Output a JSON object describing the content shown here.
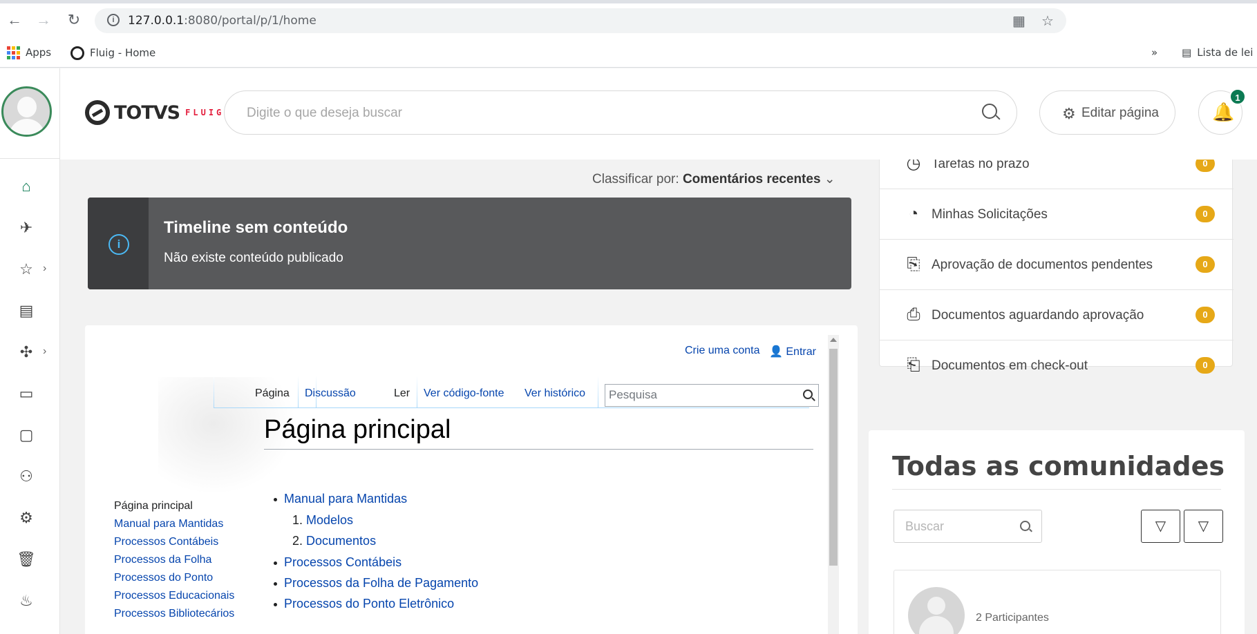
{
  "browser": {
    "back_icon": "back-arrow-icon",
    "url_host": "127.0.0.1",
    "url_rest": ":8080/portal/p/1/home",
    "bookmarks": {
      "apps": "Apps",
      "fluig": "Fluig - Home",
      "reading_list": "Lista de lei",
      "overflow": "»"
    }
  },
  "header": {
    "logo_main": "TOTVS",
    "logo_sub": "FLUIG",
    "search_placeholder": "Digite o que deseja buscar",
    "edit_page": "Editar página",
    "notification_count": "1"
  },
  "timeline": {
    "sort_label": "Classificar por:",
    "sort_value": "Comentários recentes",
    "alert_title": "Timeline sem conteúdo",
    "alert_message": "Não existe conteúdo publicado"
  },
  "wiki": {
    "create_account": "Crie uma conta",
    "login": "Entrar",
    "nav": [
      "Página principal",
      "Manual para Mantidas",
      "Processos Contábeis",
      "Processos da Folha",
      "Processos do Ponto",
      "Processos Educacionais",
      "Processos Bibliotecários"
    ],
    "tabs": {
      "page": "Página",
      "discussion": "Discussão",
      "read": "Ler",
      "view_source": "Ver código-fonte",
      "history": "Ver histórico"
    },
    "search_placeholder": "Pesquisa",
    "heading": "Página principal",
    "list": {
      "item1": "Manual para Mantidas",
      "sub1": "Modelos",
      "sub2": "Documentos",
      "item2": "Processos Contábeis",
      "item3": "Processos da Folha de Pagamento",
      "item4": "Processos do Ponto Eletrônico"
    }
  },
  "tasks": [
    {
      "label": "Tarefas no prazo",
      "count": "0",
      "icon": "clock-check-icon"
    },
    {
      "label": "Minhas Solicitações",
      "count": "0",
      "icon": "user-clock-icon"
    },
    {
      "label": "Aprovação de documentos pendentes",
      "count": "0",
      "icon": "doc-clock-icon"
    },
    {
      "label": "Documentos aguardando aprovação",
      "count": "0",
      "icon": "doc-user-icon"
    },
    {
      "label": "Documentos em check-out",
      "count": "0",
      "icon": "doc-lock-icon"
    }
  ],
  "communities": {
    "title": "Todas as comunidades",
    "search_placeholder": "Buscar",
    "participants": "2 Participantes"
  },
  "colors": {
    "brand_red": "#e31d3c",
    "badge_green": "#0c7a53",
    "count_yellow": "#e6a817",
    "alert_bg": "#58595b",
    "info_blue": "#4bb9f4",
    "wiki_link": "#0645ad"
  }
}
